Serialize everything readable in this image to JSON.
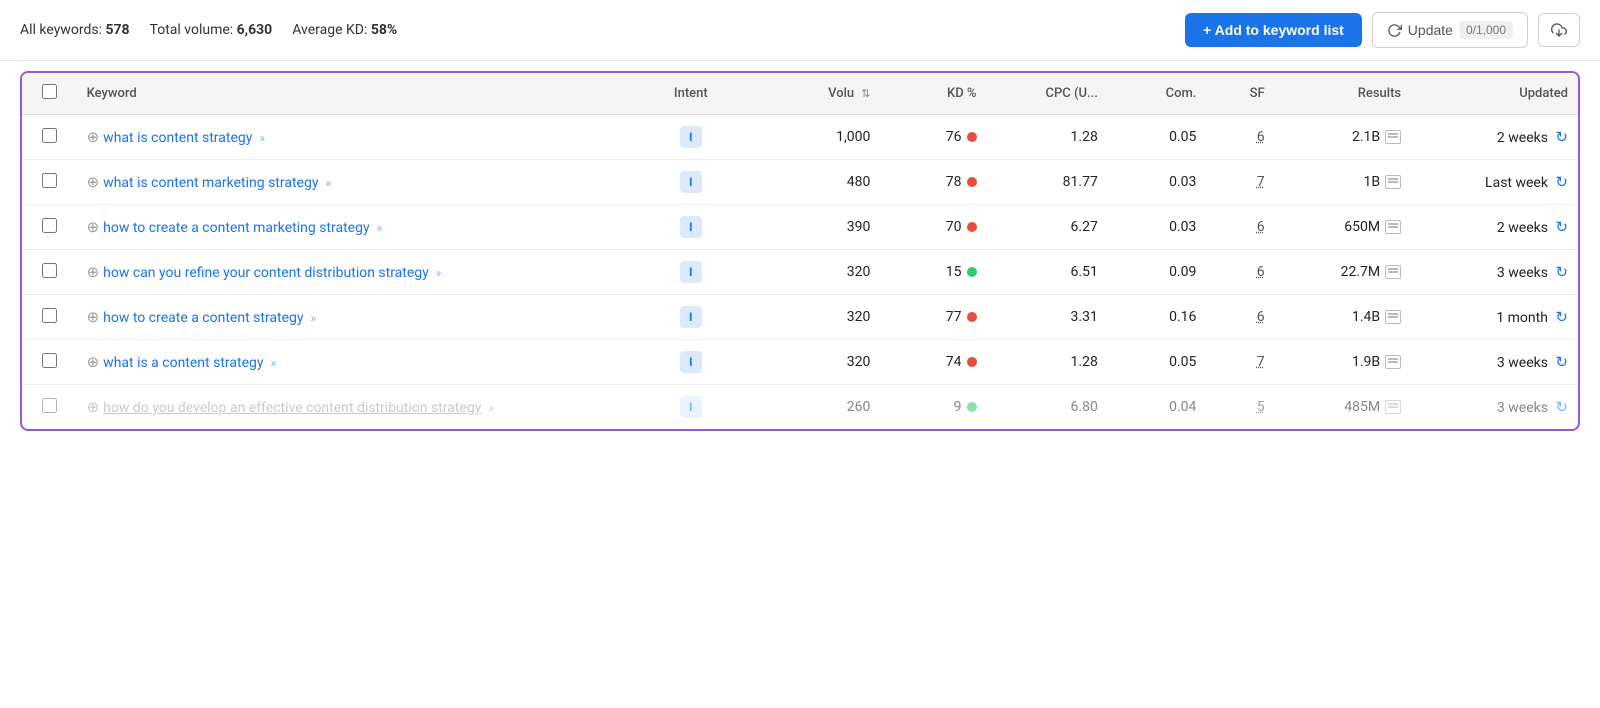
{
  "topbar": {
    "all_keywords_label": "All keywords:",
    "all_keywords_value": "578",
    "total_volume_label": "Total volume:",
    "total_volume_value": "6,630",
    "avg_kd_label": "Average KD:",
    "avg_kd_value": "58%",
    "add_button_label": "+ Add to keyword list",
    "update_button_label": "Update",
    "update_count": "0/1,000",
    "export_icon": "↑"
  },
  "table": {
    "headers": {
      "checkbox": "",
      "keyword": "Keyword",
      "intent": "Intent",
      "volume": "Volu",
      "kd": "KD %",
      "cpc": "CPC (U...",
      "com": "Com.",
      "sf": "SF",
      "results": "Results",
      "updated": "Updated"
    },
    "rows": [
      {
        "id": 1,
        "keyword": "what is content strategy",
        "intent": "I",
        "volume": "1,000",
        "kd": "76",
        "kd_color": "red",
        "cpc": "1.28",
        "com": "0.05",
        "sf": "6",
        "results": "2.1B",
        "updated": "2 weeks",
        "faded": false
      },
      {
        "id": 2,
        "keyword": "what is content marketing strategy",
        "intent": "I",
        "volume": "480",
        "kd": "78",
        "kd_color": "red",
        "cpc": "81.77",
        "com": "0.03",
        "sf": "7",
        "results": "1B",
        "updated": "Last week",
        "faded": false
      },
      {
        "id": 3,
        "keyword": "how to create a content marketing strategy",
        "intent": "I",
        "volume": "390",
        "kd": "70",
        "kd_color": "red",
        "cpc": "6.27",
        "com": "0.03",
        "sf": "6",
        "results": "650M",
        "updated": "2 weeks",
        "faded": false
      },
      {
        "id": 4,
        "keyword": "how can you refine your content distribution strategy",
        "intent": "I",
        "volume": "320",
        "kd": "15",
        "kd_color": "green",
        "cpc": "6.51",
        "com": "0.09",
        "sf": "6",
        "results": "22.7M",
        "updated": "3 weeks",
        "faded": false
      },
      {
        "id": 5,
        "keyword": "how to create a content strategy",
        "intent": "I",
        "volume": "320",
        "kd": "77",
        "kd_color": "red",
        "cpc": "3.31",
        "com": "0.16",
        "sf": "6",
        "results": "1.4B",
        "updated": "1 month",
        "faded": false
      },
      {
        "id": 6,
        "keyword": "what is a content strategy",
        "intent": "I",
        "volume": "320",
        "kd": "74",
        "kd_color": "red",
        "cpc": "1.28",
        "com": "0.05",
        "sf": "7",
        "results": "1.9B",
        "updated": "3 weeks",
        "faded": false
      },
      {
        "id": 7,
        "keyword": "how do you develop an effective content distribution strategy",
        "intent": "I",
        "volume": "260",
        "kd": "9",
        "kd_color": "green",
        "cpc": "6.80",
        "com": "0.04",
        "sf": "5",
        "results": "485M",
        "updated": "3 weeks",
        "faded": true
      }
    ]
  }
}
